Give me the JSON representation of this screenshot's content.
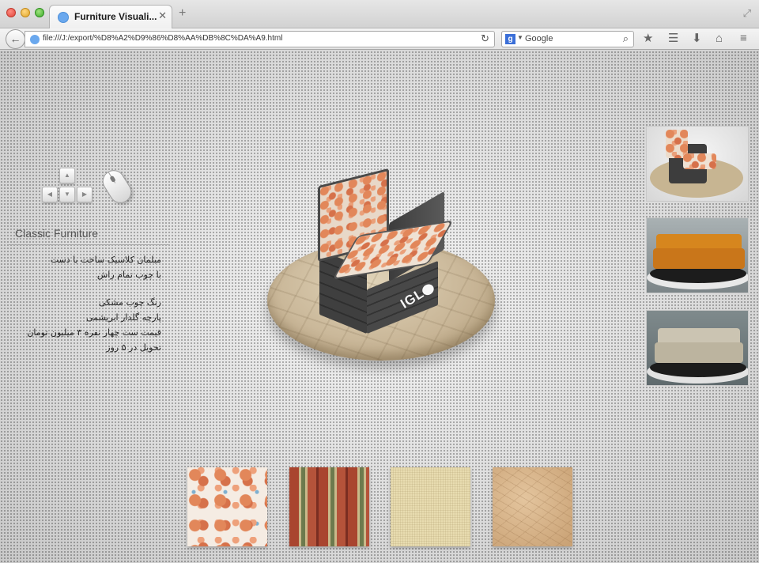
{
  "browser": {
    "tab_title": "Furniture Visuali...",
    "tab_close": "✕",
    "new_tab": "+",
    "url": "file:///J:/export/%D8%A2%D9%86%D8%AA%DB%8C%DA%A9.html",
    "search_placeholder": "Google",
    "search_engine_letter": "g"
  },
  "page": {
    "product_title": "Classic Furniture",
    "description_paragraph_1": [
      "مبلمان کلاسیک ساخت با دست",
      "با چوب تمام راش"
    ],
    "description_paragraph_2": [
      "رنگ چوب مشکی",
      "پارچه گلدار ابریشمی",
      "قیمت ست چهار نفره ۳ میلیون تومان",
      "تحویل در ۵ روز"
    ],
    "logo_text": "IGL"
  },
  "thumbnails": [
    {
      "name": "classic-chair-thumbnail"
    },
    {
      "name": "orange-sofa-thumbnail"
    },
    {
      "name": "grey-sofa-thumbnail"
    }
  ],
  "swatches": [
    {
      "name": "floral-fabric-swatch"
    },
    {
      "name": "striped-fabric-swatch"
    },
    {
      "name": "linen-fabric-swatch"
    },
    {
      "name": "leather-swatch"
    }
  ],
  "colors": {
    "fabric_orange": "#e2875a",
    "wood_black": "#3f3f3f",
    "platform_stone": "#c9b89a"
  }
}
